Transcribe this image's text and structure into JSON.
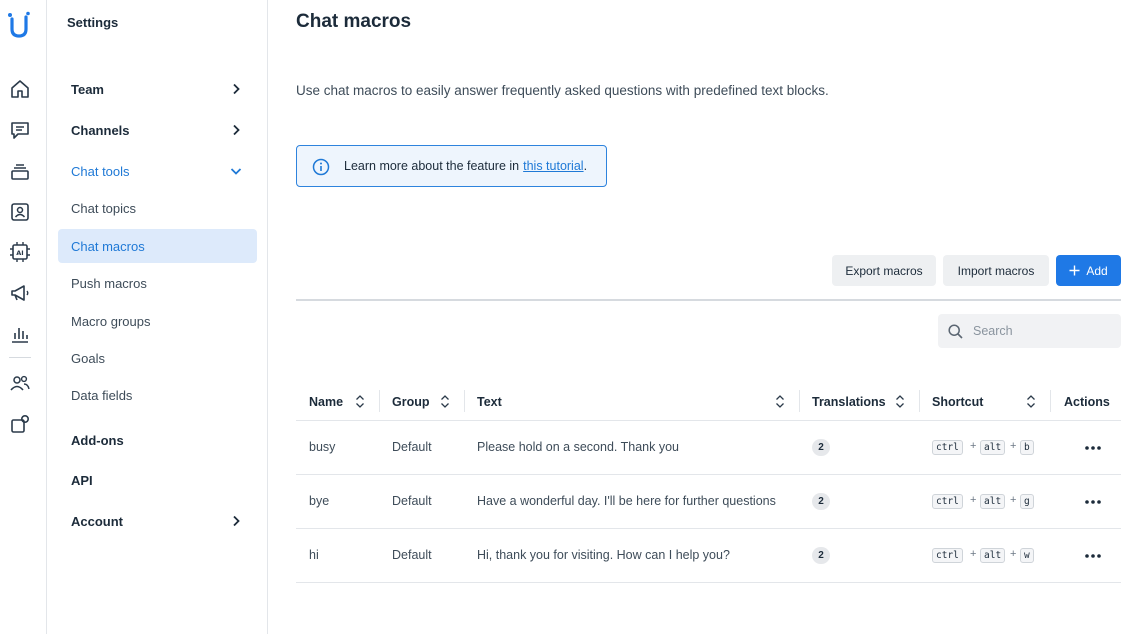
{
  "colors": {
    "accent": "#1f79e6",
    "active_bg": "#ddeafb",
    "info_border": "#2e83dd"
  },
  "rail": {
    "icons": [
      "logo-icon",
      "home-icon",
      "chat-icon",
      "stack-icon",
      "contacts-icon",
      "ai-icon",
      "megaphone-icon",
      "analytics-icon",
      "team-icon",
      "settings-icon"
    ]
  },
  "settings": {
    "title": "Settings",
    "items": [
      {
        "label": "Team"
      },
      {
        "label": "Channels"
      },
      {
        "label": "Chat tools"
      },
      {
        "label": "Chat topics"
      },
      {
        "label": "Chat macros"
      },
      {
        "label": "Push macros"
      },
      {
        "label": "Macro groups"
      },
      {
        "label": "Goals"
      },
      {
        "label": "Data fields"
      },
      {
        "label": "Add-ons"
      },
      {
        "label": "API"
      },
      {
        "label": "Account"
      }
    ]
  },
  "main": {
    "title": "Chat macros",
    "description": "Use chat macros to easily answer frequently asked questions with predefined text blocks.",
    "info_text": "Learn more about the feature in",
    "info_link": "this tutorial",
    "info_period": ".",
    "buttons": {
      "export": "Export macros",
      "import": "Import macros",
      "add": "Add"
    },
    "search_placeholder": "Search",
    "columns": {
      "name": "Name",
      "group": "Group",
      "text": "Text",
      "translations": "Translations",
      "shortcut": "Shortcut",
      "actions": "Actions"
    },
    "rows": [
      {
        "name": "busy",
        "group": "Default",
        "text": "Please hold on a second. Thank you",
        "translations": "2",
        "k1": "ctrl",
        "k2": "alt",
        "k3": "b"
      },
      {
        "name": "bye",
        "group": "Default",
        "text": "Have a wonderful day. I'll be here for further questions",
        "translations": "2",
        "k1": "ctrl",
        "k2": "alt",
        "k3": "g"
      },
      {
        "name": "hi",
        "group": "Default",
        "text": "Hi, thank you for visiting. How can I help you?",
        "translations": "2",
        "k1": "ctrl",
        "k2": "alt",
        "k3": "w"
      }
    ],
    "plus": "+"
  }
}
